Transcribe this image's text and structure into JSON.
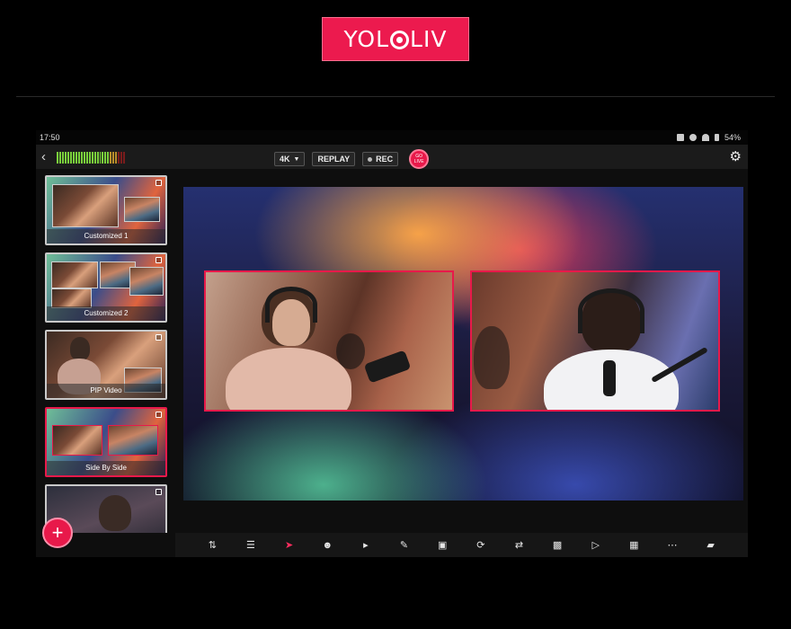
{
  "logo": {
    "text_a": "YOL",
    "text_b": "LIV",
    "brand_color": "#ec1a4e"
  },
  "status_bar": {
    "time": "17:50",
    "battery": "54%"
  },
  "toolbar": {
    "resolution": "4K",
    "replay_label": "REPLAY",
    "rec_label": "REC",
    "live_line1": "GO",
    "live_line2": "LIVE"
  },
  "layouts": [
    {
      "label": "Customized 1"
    },
    {
      "label": "Customized 2"
    },
    {
      "label": "PIP Video"
    },
    {
      "label": "Side By Side",
      "active": true
    },
    {
      "label": ""
    }
  ],
  "fab": {
    "icon": "plus-icon",
    "label": "+"
  },
  "bottom_toolbar": [
    "audio-mixer-icon",
    "layers-icon",
    "switcher-icon",
    "guests-icon",
    "volume-icon",
    "edit-icon",
    "aspect-ratio-icon",
    "replay-icon",
    "transition-icon",
    "comments-icon",
    "camera-icon",
    "overlay-icon",
    "more-icon",
    "image-icon"
  ],
  "accent_color": "#e8194a"
}
